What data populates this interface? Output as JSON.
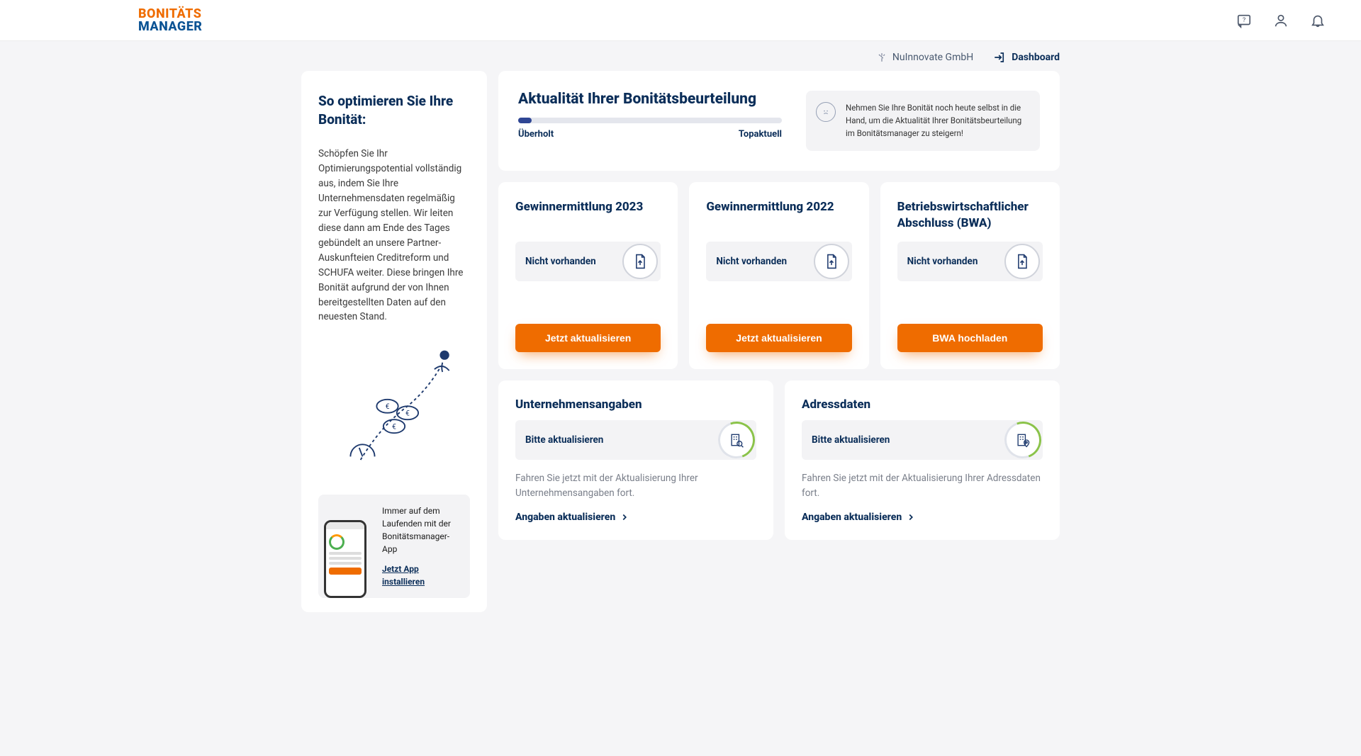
{
  "logo": {
    "line1": "BONITÄTS",
    "line2": "MANAGER"
  },
  "subheader": {
    "company": "NuInnovate GmbH",
    "dashboard": "Dashboard"
  },
  "sidebar": {
    "title": "So optimieren Sie Ihre Bonität:",
    "body": "Schöpfen Sie Ihr Optimierungspotential vollständig aus, indem Sie Ihre Unternehmensdaten regelmäßig zur Verfügung stellen. Wir leiten diese dann am Ende des Tages gebündelt an unsere Partner-Auskunfteien Creditreform und SCHUFA weiter. Diese bringen Ihre Bonität aufgrund der von Ihnen bereitgestellten Daten auf den neuesten Stand.",
    "promo_text": "Immer auf dem Laufenden mit der Bonitätsmanager-App",
    "promo_link": "Jetzt App installieren"
  },
  "actuality": {
    "title": "Aktualität Ihrer Bonitätsbeurteilung",
    "left_label": "Überholt",
    "right_label": "Topaktuell",
    "percent": 5,
    "notice": "Nehmen Sie Ihre Bonität noch heute selbst in die Hand, um die Aktualität Ihrer Bonitätsbeurteilung im Bonitätsmanager zu steigern!"
  },
  "docs": [
    {
      "title": "Gewinnermittlung 2023",
      "status": "Nicht vorhanden",
      "button": "Jetzt aktualisieren"
    },
    {
      "title": "Gewinnermittlung 2022",
      "status": "Nicht vorhanden",
      "button": "Jetzt aktualisieren"
    },
    {
      "title": "Betriebswirtschaftlicher Abschluss (BWA)",
      "status": "Nicht vorhanden",
      "button": "BWA hochladen"
    }
  ],
  "info_cards": [
    {
      "title": "Unternehmensangaben",
      "status": "Bitte aktualisieren",
      "desc": "Fahren Sie jetzt mit der Aktualisierung Ihrer Unternehmensangaben fort.",
      "link": "Angaben aktualisieren",
      "icon": "building-search"
    },
    {
      "title": "Adressdaten",
      "status": "Bitte aktualisieren",
      "desc": "Fahren Sie jetzt mit der Aktualisierung Ihrer Adressdaten fort.",
      "link": "Angaben aktualisieren",
      "icon": "building-pin"
    }
  ]
}
